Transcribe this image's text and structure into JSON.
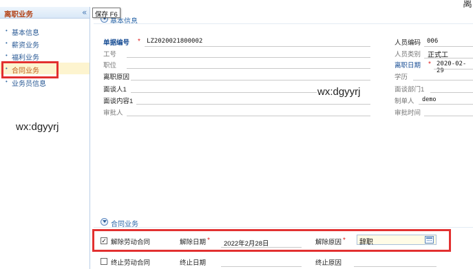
{
  "sidebar": {
    "title": "离职业务",
    "collapse_glyph": "«",
    "items": [
      {
        "label": "基本信息"
      },
      {
        "label": "薪资业务"
      },
      {
        "label": "福利业务"
      },
      {
        "label": "合同业务"
      },
      {
        "label": "业务员信息"
      }
    ]
  },
  "toolbar": {
    "tooltip": "保存 F6",
    "top_right_fragment": "离"
  },
  "watermark": "wx:dgyyrj",
  "basic_info": {
    "title": "基本信息",
    "bill_no_label": "单据编号",
    "bill_no_value": "LZ2020021800002",
    "emp_code_label": "人员编码",
    "emp_code_value": "006",
    "job_no_label": "工号",
    "emp_type_label": "人员类别",
    "emp_type_value": "正式工",
    "position_label": "职位",
    "leave_date_label": "离职日期",
    "leave_date_value": "2020-02-29",
    "leave_reason_label": "离职原因",
    "education_label": "学历",
    "interviewer_label": "面谈人1",
    "interview_dept_label": "面谈部门1",
    "interview_content_label": "面谈内容1",
    "creator_label": "制单人",
    "creator_value": "demo",
    "approver_label": "审批人",
    "approve_time_label": "审批时间"
  },
  "contract": {
    "title": "合同业务",
    "rescind_checkbox_label": "解除劳动合同",
    "rescind_checked_mark": "✓",
    "rescind_date_label": "解除日期",
    "rescind_date_value": "2022年2月28日",
    "rescind_reason_label": "解除原因",
    "rescind_reason_value": "辞职",
    "terminate_checkbox_label": "终止劳动合同",
    "terminate_date_label": "终止日期",
    "terminate_reason_label": "终止原因"
  },
  "colors": {
    "highlight_red": "#e23030",
    "accent_blue": "#2a66a8",
    "required_star": "#e02020"
  }
}
